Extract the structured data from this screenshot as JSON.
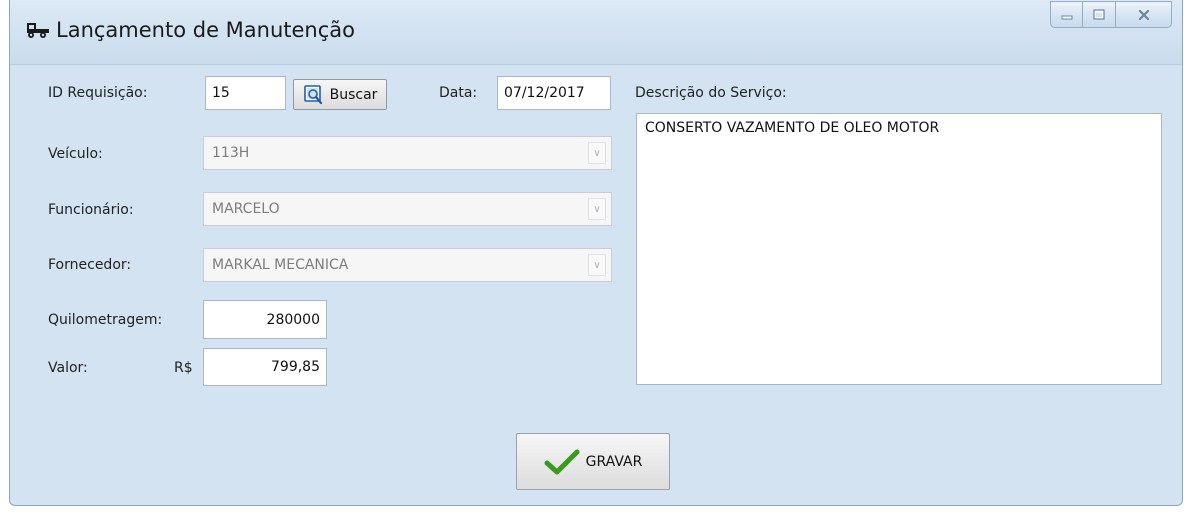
{
  "window": {
    "title": "Lançamento de Manutenção",
    "icon": "truck-icon",
    "controls": {
      "minimize": "minimize-icon",
      "maximize": "maximize-icon",
      "close": "close-icon"
    }
  },
  "form": {
    "id_requisicao": {
      "label": "ID Requisição:",
      "value": "15"
    },
    "buscar_button": {
      "label": "Buscar",
      "icon": "search-icon"
    },
    "data": {
      "label": "Data:",
      "value": "07/12/2017"
    },
    "veiculo": {
      "label": "Veículo:",
      "value": "113H"
    },
    "funcionario": {
      "label": "Funcionário:",
      "value": "MARCELO"
    },
    "fornecedor": {
      "label": "Fornecedor:",
      "value": "MARKAL MECANICA"
    },
    "quilometragem": {
      "label": "Quilometragem:",
      "value": "280000"
    },
    "valor": {
      "label": "Valor:",
      "currency": "R$",
      "value": "799,85"
    },
    "descricao": {
      "label": "Descrição do Serviço:",
      "value": "CONSERTO VAZAMENTO DE OLEO MOTOR"
    }
  },
  "gravar_button": {
    "label": "GRAVAR",
    "icon": "checkmark-icon"
  },
  "colors": {
    "window_bg": "#d4e3f2",
    "checkmark": "#3a9a1e"
  }
}
